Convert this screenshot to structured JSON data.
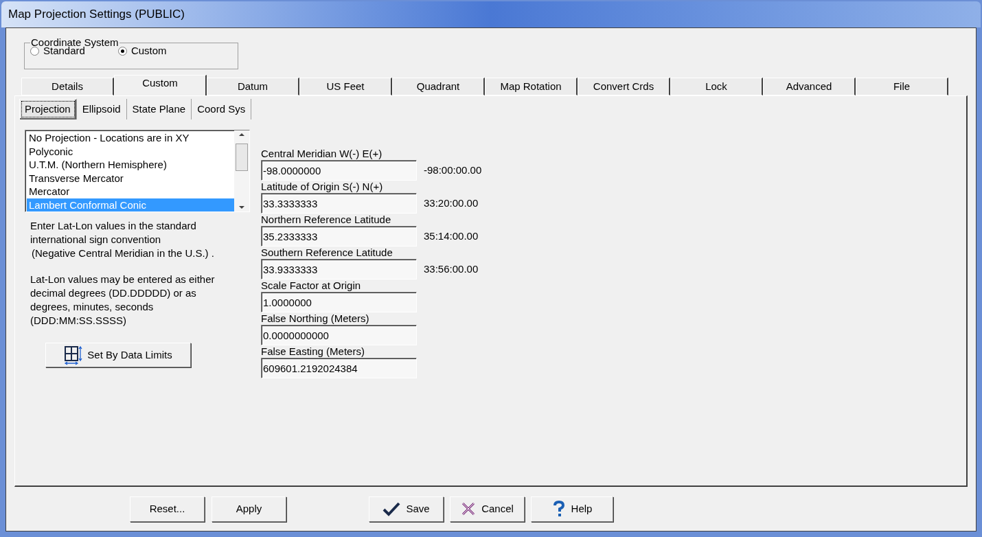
{
  "window": {
    "title": "Map Projection Settings (PUBLIC)"
  },
  "coordinate_system": {
    "label": "Coordinate System",
    "options": [
      {
        "label": "Standard",
        "selected": false
      },
      {
        "label": "Custom",
        "selected": true
      }
    ]
  },
  "tabs": [
    {
      "label": "Details",
      "selected": false
    },
    {
      "label": "Custom",
      "selected": true
    },
    {
      "label": "Datum",
      "selected": false
    },
    {
      "label": "US Feet",
      "selected": false
    },
    {
      "label": "Quadrant",
      "selected": false
    },
    {
      "label": "Map Rotation",
      "selected": false
    },
    {
      "label": "Convert Crds",
      "selected": false
    },
    {
      "label": "Lock",
      "selected": false
    },
    {
      "label": "Advanced",
      "selected": false
    },
    {
      "label": "File",
      "selected": false
    }
  ],
  "subtabs": [
    {
      "label": "Projection",
      "selected": true
    },
    {
      "label": "Ellipsoid",
      "selected": false
    },
    {
      "label": "State Plane",
      "selected": false
    },
    {
      "label": "Coord Sys",
      "selected": false
    }
  ],
  "projection_list": [
    {
      "label": "No Projection - Locations are in XY",
      "selected": false
    },
    {
      "label": "Polyconic",
      "selected": false
    },
    {
      "label": "U.T.M. (Northern Hemisphere)",
      "selected": false
    },
    {
      "label": "Transverse Mercator",
      "selected": false
    },
    {
      "label": "Mercator",
      "selected": false
    },
    {
      "label": "Lambert Conformal Conic",
      "selected": true
    }
  ],
  "help_text": [
    "Enter Lat-Lon values in the standard international sign convention",
    "(Negative Central Meridian in the U.S.) .",
    "Lat-Lon values may be entered as either decimal degrees (DD.DDDDD) or as degrees, minutes, seconds (DDD:MM:SS.SSSS)"
  ],
  "set_by_data_limits": "Set By Data Limits",
  "fields": [
    {
      "label": "Central Meridian W(-) E(+)",
      "value": "-98.0000000",
      "dms": "-98:00:00.00"
    },
    {
      "label": "Latitude of Origin S(-) N(+)",
      "value": "33.3333333",
      "dms": "33:20:00.00"
    },
    {
      "label": "Northern Reference Latitude",
      "value": "35.2333333",
      "dms": "35:14:00.00"
    },
    {
      "label": "Southern Reference Latitude",
      "value": "33.9333333",
      "dms": "33:56:00.00"
    },
    {
      "label": "Scale Factor at Origin",
      "value": "1.0000000"
    },
    {
      "label": "False Northing  (Meters)",
      "value": "0.0000000000"
    },
    {
      "label": "False Easting  (Meters)",
      "value": "609601.2192024384"
    }
  ],
  "buttons": [
    {
      "label": "Reset...",
      "kind": "plain"
    },
    {
      "label": "Apply",
      "kind": "plain"
    },
    {
      "label": "Save",
      "kind": "save"
    },
    {
      "label": "Cancel",
      "kind": "cancel"
    },
    {
      "label": "Help",
      "kind": "help"
    }
  ]
}
